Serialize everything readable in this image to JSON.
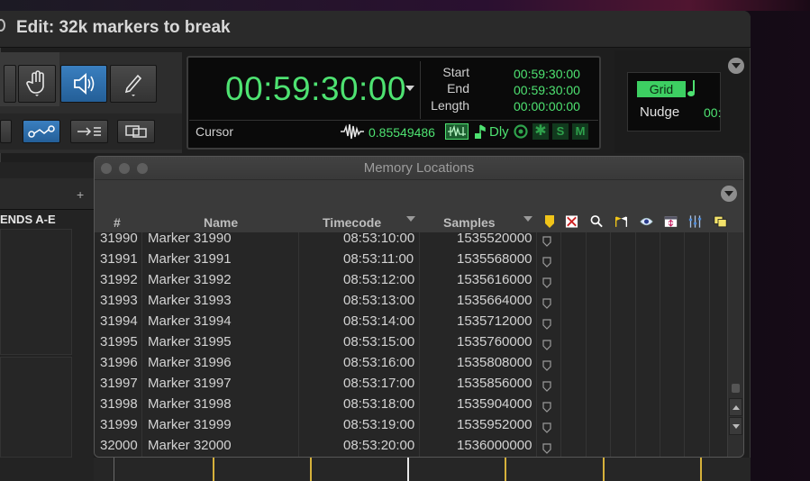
{
  "window": {
    "title": "Edit: 32k markers to break"
  },
  "counter": {
    "main_time": "00:59:30:00",
    "start_label": "Start",
    "end_label": "End",
    "length_label": "Length",
    "start_value": "00:59:30:00",
    "end_value": "00:59:30:00",
    "length_value": "00:00:00:00",
    "cursor_label": "Cursor",
    "cursor_value": "0.85549486",
    "dly_label": "Dly",
    "s_label": "S",
    "m_label": "M"
  },
  "grid": {
    "grid_label": "Grid",
    "nudge_label": "Nudge",
    "nudge_value": "00:"
  },
  "left_panel": {
    "sends_label": "ENDS A-E"
  },
  "memory": {
    "title": "Memory Locations",
    "columns": {
      "num": "#",
      "name": "Name",
      "timecode": "Timecode",
      "samples": "Samples"
    },
    "rows": [
      {
        "num": "31990",
        "name": "Marker 31990",
        "timecode": "08:53:10:00",
        "samples": "1535520000"
      },
      {
        "num": "31991",
        "name": "Marker 31991",
        "timecode": "08:53:11:00",
        "samples": "1535568000"
      },
      {
        "num": "31992",
        "name": "Marker 31992",
        "timecode": "08:53:12:00",
        "samples": "1535616000"
      },
      {
        "num": "31993",
        "name": "Marker 31993",
        "timecode": "08:53:13:00",
        "samples": "1535664000"
      },
      {
        "num": "31994",
        "name": "Marker 31994",
        "timecode": "08:53:14:00",
        "samples": "1535712000"
      },
      {
        "num": "31995",
        "name": "Marker 31995",
        "timecode": "08:53:15:00",
        "samples": "1535760000"
      },
      {
        "num": "31996",
        "name": "Marker 31996",
        "timecode": "08:53:16:00",
        "samples": "1535808000"
      },
      {
        "num": "31997",
        "name": "Marker 31997",
        "timecode": "08:53:17:00",
        "samples": "1535856000"
      },
      {
        "num": "31998",
        "name": "Marker 31998",
        "timecode": "08:53:18:00",
        "samples": "1535904000"
      },
      {
        "num": "31999",
        "name": "Marker 31999",
        "timecode": "08:53:19:00",
        "samples": "1535952000"
      },
      {
        "num": "32000",
        "name": "Marker 32000",
        "timecode": "08:53:20:00",
        "samples": "1536000000"
      }
    ]
  },
  "colors": {
    "accent_green": "#4ee271",
    "marker_yellow": "#d6b13a",
    "tool_blue": "#2f6fae"
  }
}
